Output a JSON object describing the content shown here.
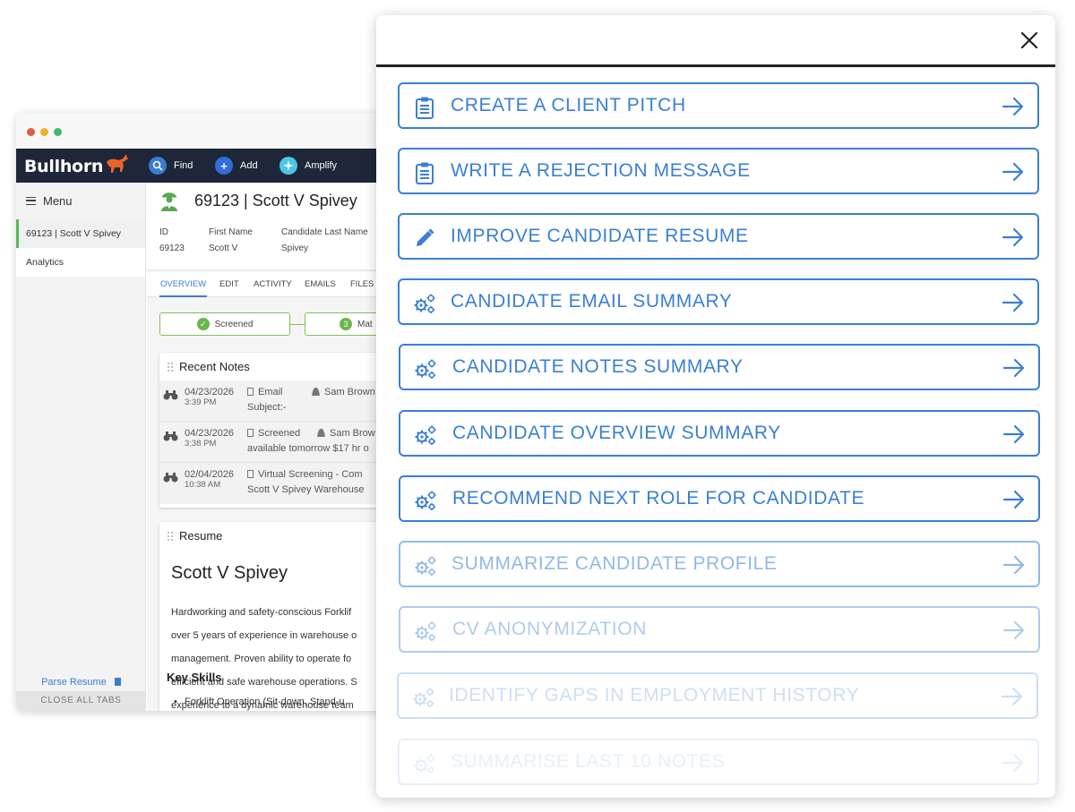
{
  "app": {
    "brand": "Bullhorn",
    "nav": {
      "find": "Find",
      "add": "Add",
      "amplify": "Amplify"
    },
    "sidebar": {
      "menu_label": "Menu",
      "tabs": [
        "69123 | Scott V Spivey",
        "Analytics"
      ],
      "parse_resume": "Parse Resume",
      "close_all_tabs": "CLOSE ALL TABS"
    },
    "record": {
      "title": "69123 | Scott V Spivey",
      "fields": [
        {
          "label": "ID",
          "value": "69123"
        },
        {
          "label": "First Name",
          "value": "Scott V"
        },
        {
          "label": "Candidate Last Name",
          "value": "Spivey"
        }
      ],
      "tabs": [
        "OVERVIEW",
        "EDIT",
        "ACTIVITY",
        "EMAILS",
        "FILES"
      ],
      "pipeline": [
        {
          "label": "Screened",
          "badge": "✓"
        },
        {
          "label": "Mat",
          "badge": "3"
        }
      ]
    },
    "recent_notes": {
      "title": "Recent Notes",
      "items": [
        {
          "date": "04/23/2026",
          "time": "3:39 PM",
          "action": "Email",
          "user": "Sam Brown",
          "detail": "Subject:-"
        },
        {
          "date": "04/23/2026",
          "time": "3:38 PM",
          "action": "Screened",
          "user": "Sam Brow",
          "detail": "available tomorrow $17 hr o"
        },
        {
          "date": "02/04/2026",
          "time": "10:38 AM",
          "action": "Virtual Screening - Com",
          "user": "",
          "detail": "Scott V Spivey Warehouse"
        }
      ]
    },
    "resume": {
      "title": "Resume",
      "name": "Scott V Spivey",
      "summary_lines": [
        "Hardworking and safety-conscious Forklif",
        "over 5 years of experience in warehouse o",
        "management. Proven ability to operate fo",
        "efficient and safe warehouse operations. S",
        "experience to a dynamic warehouse team"
      ],
      "key_skills_heading": "Key Skills",
      "skills": [
        "Forklift Operation (Sit-down, Stand-u"
      ]
    }
  },
  "panel": {
    "close_icon": "close-icon",
    "accent_color": "#3a7fd5",
    "actions": [
      {
        "label": "CREATE A CLIENT PITCH",
        "icon": "clipboard-icon",
        "opacity": 1
      },
      {
        "label": "WRITE A REJECTION MESSAGE",
        "icon": "clipboard-icon",
        "opacity": 1
      },
      {
        "label": "IMPROVE CANDIDATE RESUME",
        "icon": "pencil-icon",
        "opacity": 1
      },
      {
        "label": "CANDIDATE EMAIL SUMMARY",
        "icon": "gears-icon",
        "opacity": 1
      },
      {
        "label": "CANDIDATE NOTES SUMMARY",
        "icon": "gears-icon",
        "opacity": 1
      },
      {
        "label": "CANDIDATE OVERVIEW SUMMARY",
        "icon": "gears-icon",
        "opacity": 1
      },
      {
        "label": "RECOMMEND NEXT ROLE FOR CANDIDATE",
        "icon": "gears-icon",
        "opacity": 1
      },
      {
        "label": "SUMMARIZE CANDIDATE PROFILE",
        "icon": "gears-icon",
        "opacity": 0.55
      },
      {
        "label": "CV ANONYMIZATION",
        "icon": "gears-icon",
        "opacity": 0.4
      },
      {
        "label": "IDENTIFY GAPS IN EMPLOYMENT HISTORY",
        "icon": "gears-icon",
        "opacity": 0.25
      },
      {
        "label": "SUMMARISE LAST 10 NOTES",
        "icon": "gears-icon",
        "opacity": 0.12
      }
    ]
  }
}
